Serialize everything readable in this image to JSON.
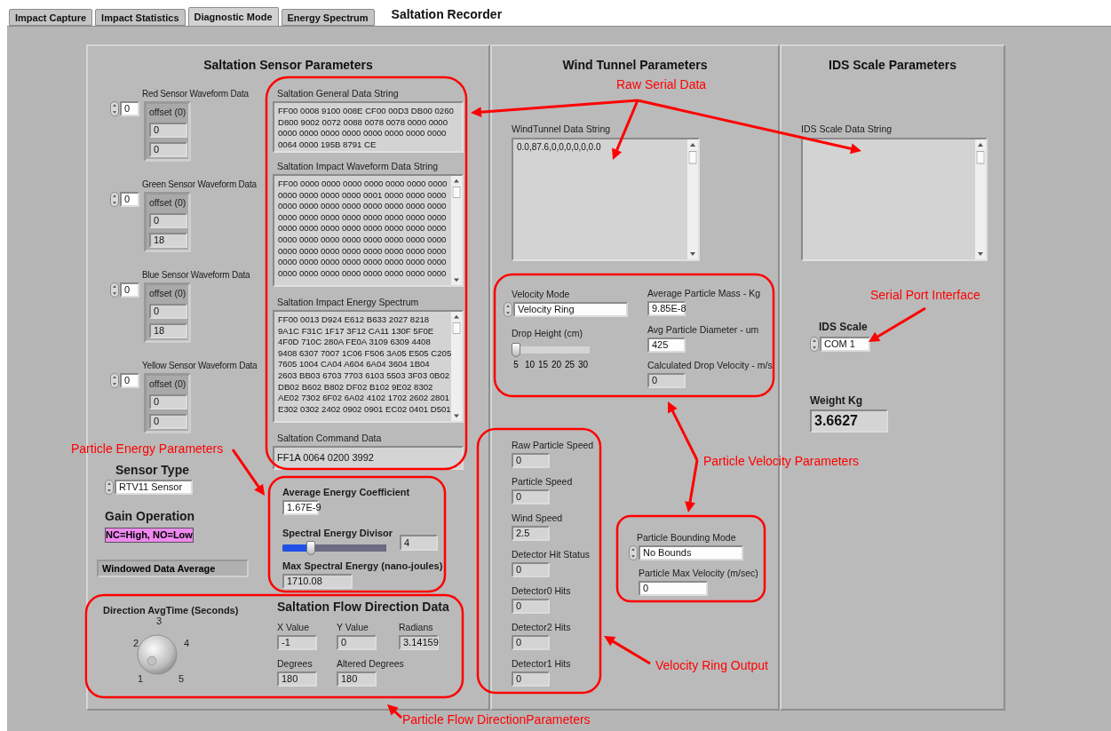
{
  "tabs": [
    {
      "label": "Impact Capture",
      "selected": false
    },
    {
      "label": "Impact Statistics",
      "selected": false
    },
    {
      "label": "Diagnostic Mode",
      "selected": true
    },
    {
      "label": "Energy Spectrum",
      "selected": false
    }
  ],
  "title": "Saltation Recorder",
  "sensor": {
    "title": "Saltation Sensor Parameters",
    "waveforms": [
      {
        "label": "Red Sensor Waveform Data",
        "index": "0",
        "offset": "offset (0)",
        "values": [
          "0",
          "0"
        ]
      },
      {
        "label": "Green Sensor Waveform Data",
        "index": "0",
        "offset": "offset (0)",
        "values": [
          "0",
          "18"
        ]
      },
      {
        "label": "Blue Sensor Waveform Data",
        "index": "0",
        "offset": "offset (0)",
        "values": [
          "0",
          "18"
        ]
      },
      {
        "label": "Yellow Sensor Waveform Data",
        "index": "0",
        "offset": "offset (0)",
        "values": [
          "0",
          "0"
        ]
      }
    ],
    "general": {
      "label": "Saltation General Data String",
      "lines": [
        "FF00 0008 9100 008E CF00 00D3 DB00 0260",
        "D800 9002 0072 0088 0078 0078 0000 0000",
        "0000 0000 0000 0000 0000 0000 0000 0000",
        "0064 0000 195B 8791 CE"
      ]
    },
    "impact_waveform": {
      "label": "Saltation Impact Waveform Data String",
      "lines": [
        "FF00 0000 0000 0000 0000 0000 0000 0000",
        "0000 0000 0000 0000 0001 0000 0000 0000",
        "0000 0000 0000 0000 0000 0000 0000 0000",
        "0000 0000 0000 0000 0000 0000 0000 0000",
        "0000 0000 0000 0000 0000 0000 0000 0000",
        "0000 0000 0000 0000 0000 0000 0000 0000",
        "0000 0000 0000 0000 0000 0000 0000 0000",
        "0000 0000 0000 0000 0000 0000 0000 0000",
        "0000 0000 0000 0000 0000 0000 0000 0000"
      ]
    },
    "energy_spectrum": {
      "label": "Saltation Impact Energy Spectrum",
      "lines": [
        "FF00 0013 D924 E612 B633 2027 8218",
        "9A1C F31C 1F17 3F12 CA11 130F 5F0E",
        "4F0D 710C 280A FE0A 3109 6309 4408",
        "9408 6307 7007 1C06 F506 3A05 E505 C205",
        "7605 1004 CA04 A604 6A04 3604 1B04",
        "2603 BB03 6703 7703 6103 5503 3F03 0B02",
        "DB02 B602 B802 DF02 B102 9E02 8302",
        "AE02 7302 6F02 6A02 4102 1702 2602 2801",
        "E302 0302 2402 0902 0901 EC02 0401 D501"
      ]
    },
    "command": {
      "label": "Saltation Command Data",
      "value": "FF1A 0064 0200 3992"
    },
    "sensor_type": {
      "label": "Sensor Type",
      "value": "RTV11 Sensor"
    },
    "gain": {
      "label": "Gain Operation",
      "value": "NC=High, NO=Low"
    },
    "windowed": "Windowed Data Average",
    "energy": {
      "coefficient_label": "Average Energy Coefficient",
      "coefficient": "1.67E-9",
      "divisor_label": "Spectral Energy Divisor",
      "level": 0.25,
      "divisor": "4",
      "max_label": "Max Spectral Energy (nano-joules)",
      "max": "1710.08"
    },
    "direction": {
      "knob_label": "Direction AvgTime (Seconds)",
      "knob_ticks": [
        "1",
        "2",
        "3",
        "4",
        "5"
      ],
      "title": "Saltation Flow Direction Data",
      "fields": [
        {
          "label": "X Value",
          "value": "-1"
        },
        {
          "label": "Y Value",
          "value": "0"
        },
        {
          "label": "Radians",
          "value": "3.14159"
        },
        {
          "label": "Degrees",
          "value": "180"
        },
        {
          "label": "Altered Degrees",
          "value": "180"
        }
      ]
    }
  },
  "wind": {
    "title": "Wind Tunnel Parameters",
    "data": {
      "label": "WindTunnel Data String",
      "value": "0.0,87.6,0,0,0,0,0,0.0"
    },
    "velocity_mode": {
      "label": "Velocity Mode",
      "value": "Velocity Ring"
    },
    "drop_height": {
      "label": "Drop Height (cm)",
      "level": 0,
      "ticks": [
        "5",
        "10",
        "15",
        "20",
        "25",
        "30"
      ]
    },
    "mass": {
      "label": "Average Particle Mass - Kg",
      "value": "9.85E-8"
    },
    "diameter": {
      "label": "Avg Particle Diameter - um",
      "value": "425"
    },
    "drop_velocity": {
      "label": "Calculated Drop Velocity - m/s",
      "value": "0"
    },
    "outputs": [
      {
        "label": "Raw Particle Speed",
        "value": "0"
      },
      {
        "label": "Particle Speed",
        "value": "0"
      },
      {
        "label": "Wind Speed",
        "value": "2.5"
      },
      {
        "label": "Detector Hit Status",
        "value": "0"
      },
      {
        "label": "Detector0 Hits",
        "value": "0"
      },
      {
        "label": "Detector2 Hits",
        "value": "0"
      },
      {
        "label": "Detector1 Hits",
        "value": "0"
      }
    ],
    "bounding": {
      "label": "Particle Bounding Mode",
      "value": "No Bounds"
    },
    "max_velocity": {
      "label": "Particle Max Velocity (m/sec)",
      "value": "0"
    }
  },
  "ids": {
    "title": "IDS Scale Parameters",
    "data_label": "IDS Scale Data String",
    "port": {
      "label": "IDS Scale",
      "value": "COM 1"
    },
    "weight": {
      "label": "Weight Kg",
      "value": "3.6627"
    }
  },
  "annotations": [
    "Raw Serial Data",
    "Serial Port Interface",
    "Particle Energy Parameters",
    "Particle Velocity Parameters",
    "Velocity Ring Output",
    "Particle Flow DirectionParameters"
  ]
}
